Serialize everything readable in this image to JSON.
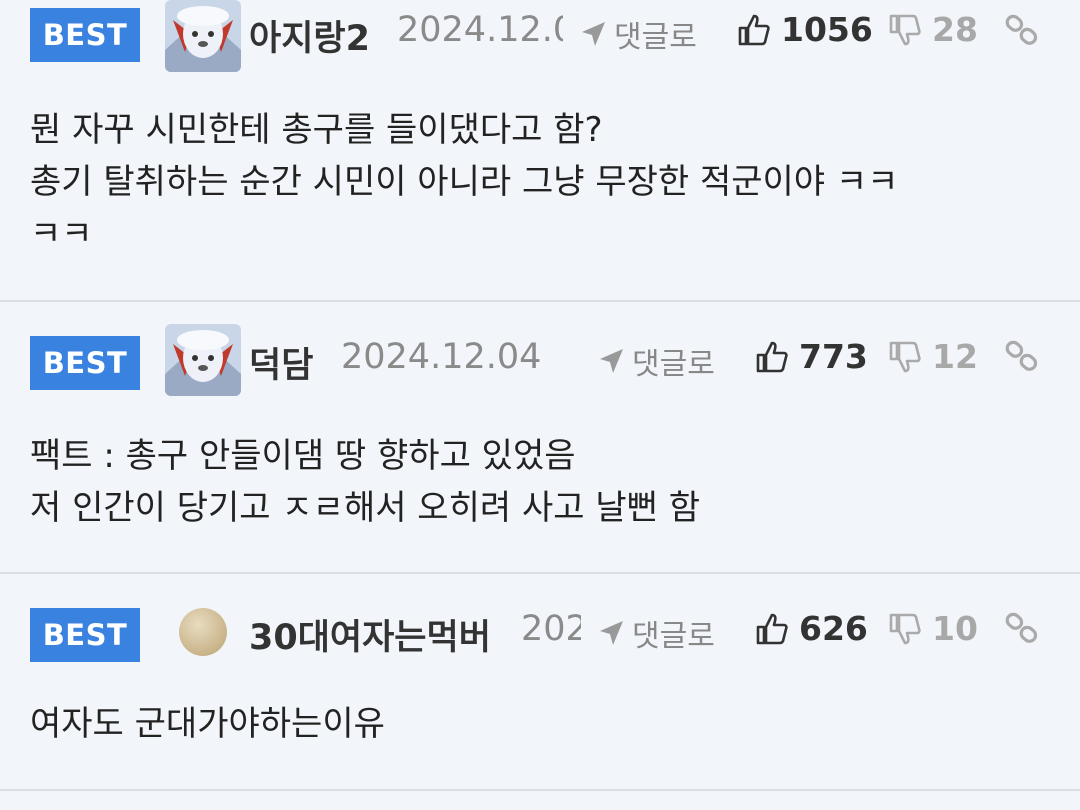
{
  "comments": [
    {
      "badge": "BEST",
      "nickname": "아지랑2",
      "date": "2024.12.0",
      "reply_label": "댓글로",
      "likes": "1056",
      "dislikes": "28",
      "lines": [
        "뭔 자꾸 시민한테 총구를 들이댔다고 함?",
        "총기 탈취하는 순간 시민이 아니라 그냥 무장한 적군이야 ㅋㅋ",
        "ㅋㅋ"
      ]
    },
    {
      "badge": "BEST",
      "nickname": "덕담",
      "date": "2024.12.04",
      "reply_label": "댓글로",
      "likes": "773",
      "dislikes": "12",
      "lines": [
        "팩트 : 총구 안들이댐 땅 향하고 있었음",
        "저 인간이 당기고 ㅈㄹ해서 오히려 사고 날뻔 함"
      ]
    },
    {
      "badge": "BEST",
      "nickname": "30대여자는먹버",
      "date": "202",
      "reply_label": "댓글로",
      "likes": "626",
      "dislikes": "10",
      "lines": [
        "여자도 군대가야하는이유"
      ]
    }
  ],
  "colors": {
    "badge": "#3a82e0",
    "background": "#f2f5f9",
    "divider": "#d9dfe7"
  }
}
